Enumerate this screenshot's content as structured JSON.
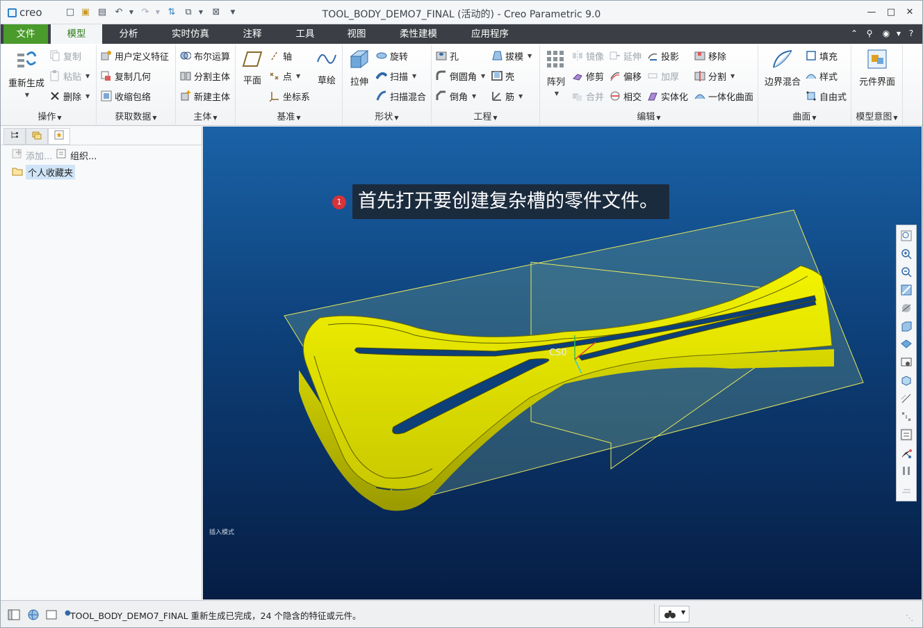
{
  "app": {
    "logo": "creo",
    "window_title": "TOOL_BODY_DEMO7_FINAL (活动的) - Creo Parametric 9.0"
  },
  "tabs": [
    {
      "label": "文件"
    },
    {
      "label": "模型"
    },
    {
      "label": "分析"
    },
    {
      "label": "实时仿真"
    },
    {
      "label": "注释"
    },
    {
      "label": "工具"
    },
    {
      "label": "视图"
    },
    {
      "label": "柔性建模"
    },
    {
      "label": "应用程序"
    }
  ],
  "ribbon": {
    "operations": {
      "label": "操作",
      "regenerate": "重新生成",
      "copy": "复制",
      "paste": "粘贴",
      "delete": "删除"
    },
    "get_data": {
      "label": "获取数据",
      "udf": "用户定义特征",
      "copy_geom": "复制几何",
      "shrinkwrap": "收缩包络"
    },
    "body": {
      "label": "主体",
      "boolean": "布尔运算",
      "split_body": "分割主体",
      "new_body": "新建主体"
    },
    "datum": {
      "label": "基准",
      "plane": "平面",
      "axis": "轴",
      "point": "点",
      "csys": "坐标系",
      "sketch": "草绘"
    },
    "shapes": {
      "label": "形状",
      "extrude": "拉伸",
      "revolve": "旋转",
      "sweep": "扫描",
      "swept_blend": "扫描混合"
    },
    "engineering": {
      "label": "工程",
      "hole": "孔",
      "round": "倒圆角",
      "chamfer": "倒角",
      "draft": "拔模",
      "shell": "壳",
      "rib": "筋"
    },
    "editing": {
      "label": "编辑",
      "pattern": "阵列",
      "mirror": "镜像",
      "extend": "延伸",
      "project": "投影",
      "trim": "修剪",
      "offset": "偏移",
      "thicken": "加厚",
      "merge": "合并",
      "intersect": "相交",
      "solidify": "实体化",
      "remove": "移除",
      "split": "分割",
      "unify": "一体化曲面"
    },
    "surfaces": {
      "label": "曲面",
      "boundary_blend": "边界混合",
      "fill": "填充",
      "style": "样式",
      "freestyle": "自由式"
    },
    "model_intent": {
      "label": "模型意图",
      "component_interface": "元件界面"
    }
  },
  "left_panel": {
    "add": "添加...",
    "organize": "组织...",
    "favorites": "个人收藏夹"
  },
  "viewport": {
    "callout_number": "1",
    "callout_text": "首先打开要创建复杂槽的零件文件。",
    "csys_label": "CS0",
    "mode_label": "插入模式"
  },
  "status": {
    "message": "TOOL_BODY_DEMO7_FINAL 重新生成已完成，24 个隐含的特征或元件。"
  },
  "colors": {
    "file_tab": "#4a9a2c",
    "tab_bar": "#3b3f45",
    "part": "#e6e600",
    "viewport_top": "#1a62a6",
    "viewport_bottom": "#061d44",
    "callout_badge": "#d6333a"
  }
}
